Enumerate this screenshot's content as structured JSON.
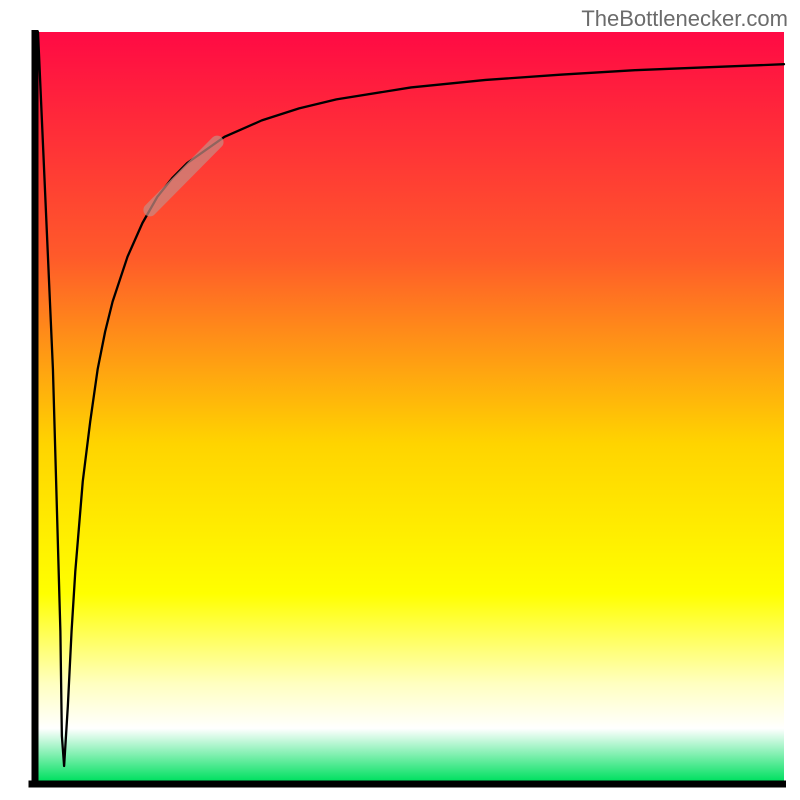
{
  "attribution": "TheBottlenecker.com",
  "chart_data": {
    "type": "line",
    "title": "",
    "xlabel": "",
    "ylabel": "",
    "xlim": [
      0,
      100
    ],
    "ylim": [
      0,
      100
    ],
    "background_gradient": {
      "stops": [
        {
          "offset": 0,
          "color": "#ff0a44"
        },
        {
          "offset": 30,
          "color": "#ff5a2a"
        },
        {
          "offset": 55,
          "color": "#ffd400"
        },
        {
          "offset": 75,
          "color": "#ffff00"
        },
        {
          "offset": 87,
          "color": "#ffffc0"
        },
        {
          "offset": 93,
          "color": "#ffffff"
        },
        {
          "offset": 100,
          "color": "#00e060"
        }
      ]
    },
    "axis_color": "#000000",
    "curve_color": "#000000",
    "marker": {
      "color": "#c88a82",
      "x_range": [
        15,
        24
      ],
      "y_range": [
        80,
        85
      ]
    },
    "x": [
      0,
      2,
      3,
      3.2,
      3.5,
      4,
      4.5,
      5,
      6,
      7,
      8,
      9,
      10,
      12,
      14,
      16,
      18,
      20,
      25,
      30,
      35,
      40,
      50,
      60,
      70,
      80,
      90,
      100
    ],
    "values": [
      100,
      55,
      20,
      6,
      2,
      10,
      20,
      28,
      40,
      48,
      55,
      60,
      64,
      70,
      74.5,
      78,
      80.5,
      82.5,
      86,
      88.2,
      89.8,
      91,
      92.6,
      93.6,
      94.3,
      94.9,
      95.3,
      95.7
    ]
  }
}
